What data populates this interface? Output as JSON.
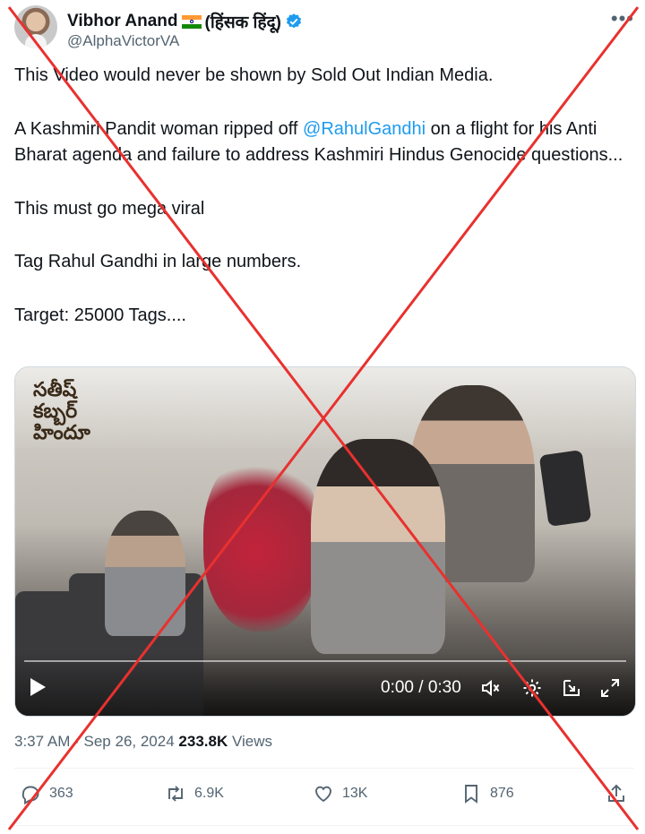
{
  "author": {
    "display_name": "Vibhor Anand",
    "name_suffix": "(हिंसक हिंदू)",
    "handle": "@AlphaVictorVA",
    "flag_icon": "india-flag-icon",
    "verified_color": "#1d9bf0"
  },
  "tweet": {
    "line1": "This Video would never be shown by Sold Out Indian Media.",
    "line2_before": "A Kashmiri Pandit woman ripped off ",
    "mention": "@RahulGandhi",
    "line2_after": " on a flight for his Anti Bharat agenda and failure to address Kashmiri Hindus Genocide questions...",
    "line3": "This must go mega viral",
    "line4": "Tag Rahul Gandhi in large numbers.",
    "line5": "Target: 25000 Tags...."
  },
  "video": {
    "watermark_line1": "సతీష్ కబ్బర్",
    "watermark_line2": "హిందూ",
    "time": "0:00 / 0:30",
    "progress": 0
  },
  "meta": {
    "time": "3:37 AM",
    "separator": "·",
    "date": "Sep 26, 2024",
    "views_count": "233.8K",
    "views_label": "Views"
  },
  "actions": {
    "replies": "363",
    "reposts": "6.9K",
    "likes": "13K",
    "bookmarks": "876"
  },
  "colors": {
    "link": "#1d9bf0",
    "muted": "#536471",
    "cross": "#e8312f"
  }
}
